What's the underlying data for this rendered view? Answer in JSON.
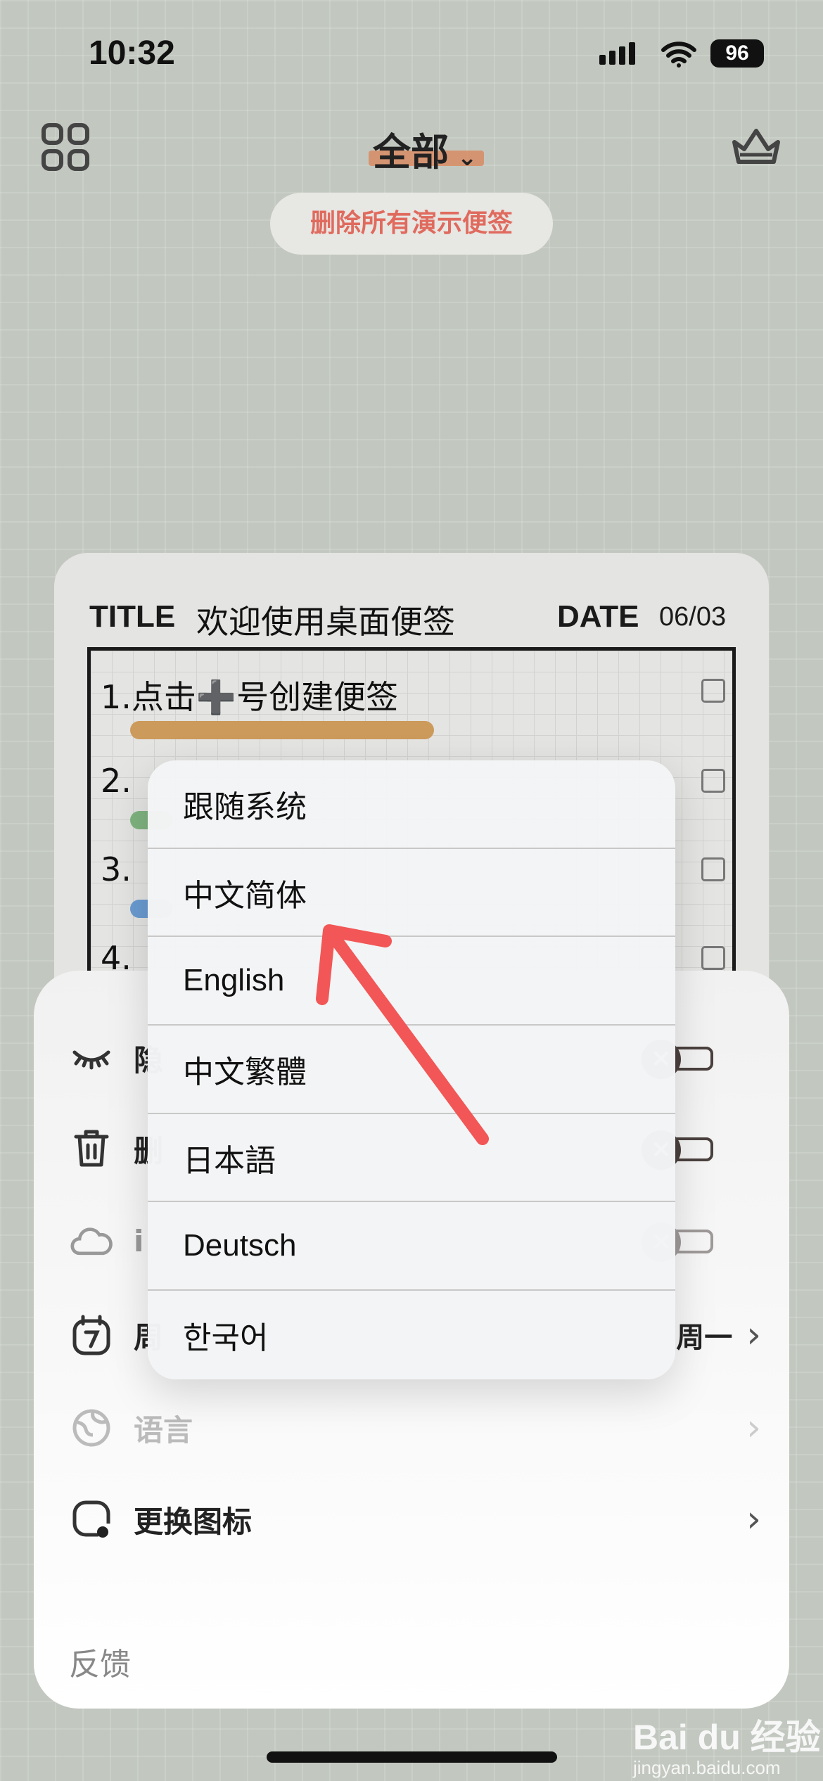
{
  "status_bar": {
    "time": "10:32",
    "battery": "96"
  },
  "header": {
    "title": "全部",
    "delete_demo_label": "删除所有演示便签"
  },
  "note": {
    "title_label": "TITLE",
    "title": "欢迎使用桌面便签",
    "date_label": "DATE",
    "date": "06/03",
    "tasks": [
      {
        "text": "1.点击➕号创建便签",
        "color": "#cc9a5a"
      },
      {
        "text": "2.",
        "color": "#7fb37f"
      },
      {
        "text": "3.",
        "color": "#6a9bd1"
      },
      {
        "text": "4.",
        "color": ""
      }
    ]
  },
  "settings": {
    "rows": [
      {
        "label": "隐",
        "icon": "eye-closed-icon",
        "toggle": "off"
      },
      {
        "label": "删",
        "icon": "trash-icon",
        "toggle": "off"
      },
      {
        "label": "i",
        "icon": "cloud-icon",
        "toggle": "off-disabled"
      },
      {
        "label": "周",
        "icon": "calendar-7-icon",
        "value": "周一"
      },
      {
        "label": "语言",
        "icon": "globe-icon"
      },
      {
        "label": "更换图标",
        "icon": "app-icon"
      }
    ],
    "feedback": "反馈"
  },
  "language_menu": {
    "items": [
      "跟随系统",
      "中文简体",
      "English",
      "中文繁體",
      "日本語",
      "Deutsch",
      "한국어"
    ]
  },
  "watermark": {
    "text": "Bai du 经验",
    "url_text": "jingyan.baidu.com"
  },
  "colors": {
    "accent_red": "#e06a5e",
    "annotation_arrow": "#f25656"
  }
}
